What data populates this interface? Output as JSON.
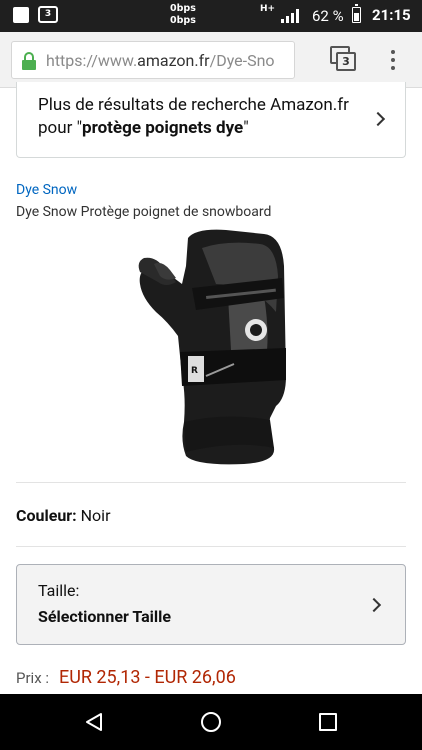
{
  "status_bar": {
    "notification_count": "3",
    "net_up": "0bps",
    "net_down": "0bps",
    "network_type": "H+",
    "battery_percent": "62 %",
    "battery_level": 0.62,
    "time": "21:15"
  },
  "browser": {
    "url_prefix": "https://www.",
    "url_host": "amazon.fr",
    "url_path": "/Dye-Sno",
    "tab_count": "3",
    "icons": {
      "lock": "lock-icon",
      "tabs": "tabs-icon",
      "menu": "overflow-menu-icon"
    }
  },
  "results_card": {
    "line1": "Plus de résultats de recherche Amazon.fr",
    "line2_prefix": "pour \"",
    "query": "protège poignets dye",
    "line2_suffix": "\""
  },
  "product": {
    "brand": "Dye Snow",
    "title": "Dye Snow Protège poignet de snowboard",
    "image_icon": "wrist-guard-image",
    "color_label": "Couleur:",
    "color_value": "Noir",
    "size_label": "Taille:",
    "size_value": "Sélectionner Taille",
    "price_label": "Prix :",
    "price_value": "EUR 25,13 - EUR 26,06"
  },
  "colors": {
    "link": "#0066c0",
    "price": "#b12704",
    "url_lock": "#4caf50"
  }
}
